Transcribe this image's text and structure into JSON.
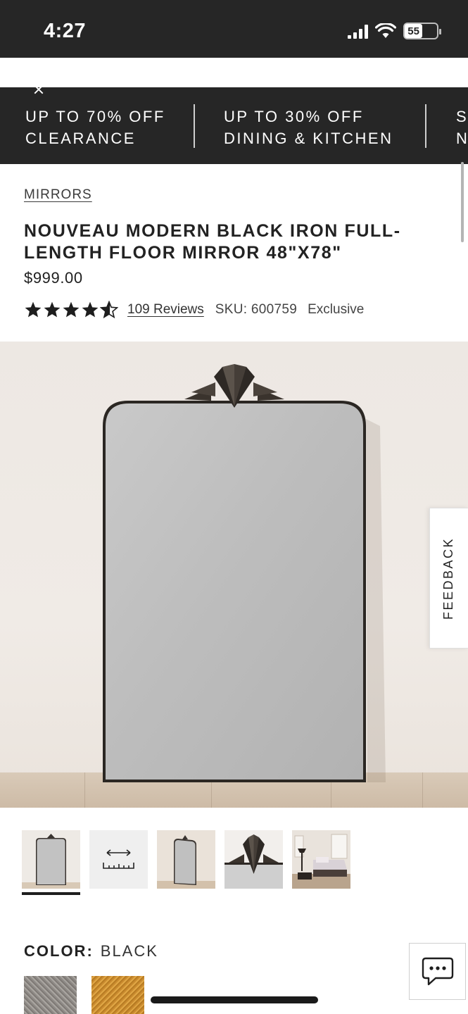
{
  "status_bar": {
    "time": "4:27",
    "battery": "55",
    "colors": {
      "background": "#262626",
      "text": "#ffffff"
    }
  },
  "promo_banner": {
    "items": [
      {
        "line1": "UP TO 70% OFF",
        "line2": "CLEARANCE"
      },
      {
        "line1": "UP TO 30% OFF",
        "line2": "DINING & KITCHEN"
      },
      {
        "line1": "S",
        "line2": "N"
      }
    ]
  },
  "product": {
    "breadcrumb": "MIRRORS",
    "title": "NOUVEAU MODERN BLACK IRON FULL-LENGTH FLOOR MIRROR 48\"X78\"",
    "price": "$999.00",
    "rating": 4.5,
    "reviews_label": "109 Reviews",
    "sku_label": "SKU: 600759",
    "badge": "Exclusive"
  },
  "feedback_tab": {
    "label": "FEEDBACK"
  },
  "gallery": {
    "active_index": 0,
    "thumbnails": [
      {
        "icon": "mirror-front-thumb"
      },
      {
        "icon": "dimensions-ruler-icon"
      },
      {
        "icon": "mirror-angle-thumb"
      },
      {
        "icon": "mirror-crest-detail-thumb"
      },
      {
        "icon": "bedroom-scene-thumb"
      }
    ]
  },
  "color": {
    "label": "COLOR:",
    "value": "BLACK",
    "swatches": [
      {
        "name": "stone",
        "color": "#9a9591"
      },
      {
        "name": "brass",
        "color": "#d39a3c"
      }
    ]
  },
  "chat": {
    "icon": "chat-bubble-icon"
  }
}
